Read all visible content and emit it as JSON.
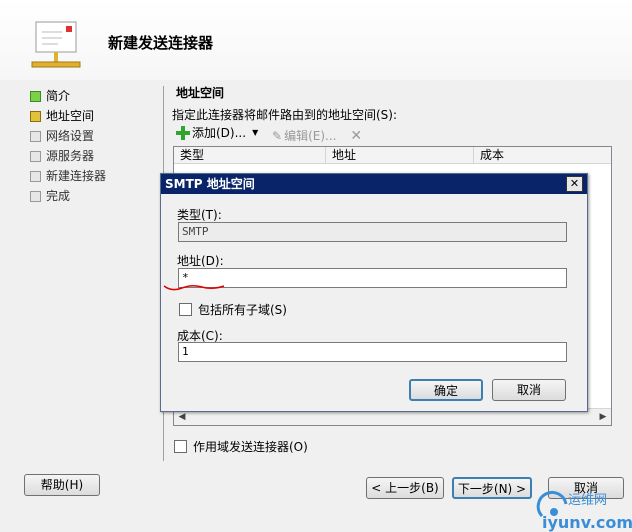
{
  "wizard": {
    "title": "新建发送连接器",
    "steps": [
      {
        "label": "简介",
        "state": "done"
      },
      {
        "label": "地址空间",
        "state": "current"
      },
      {
        "label": "网络设置",
        "state": "pending"
      },
      {
        "label": "源服务器",
        "state": "pending"
      },
      {
        "label": "新建连接器",
        "state": "pending"
      },
      {
        "label": "完成",
        "state": "pending"
      }
    ]
  },
  "main": {
    "section_title": "地址空间",
    "description": "指定此连接器将邮件路由到的地址空间(S):",
    "toolbar": {
      "add": "添加(D)...",
      "edit": "编辑(E)..."
    },
    "columns": [
      "类型",
      "地址",
      "成本"
    ],
    "scoped_checkbox": "作用域发送连接器(O)"
  },
  "buttons": {
    "help": "帮助(H)",
    "back": "< 上一步(B)",
    "next": "下一步(N) >",
    "cancel": "取消"
  },
  "dialog": {
    "title": "SMTP 地址空间",
    "close": "✕",
    "type_label": "类型(T):",
    "type_value": "SMTP",
    "address_label": "地址(D):",
    "address_value": "*",
    "subdomains_label": "包括所有子域(S)",
    "cost_label": "成本(C):",
    "cost_value": "1",
    "ok": "确定",
    "cancel": "取消"
  },
  "watermark": {
    "brand": "运维网",
    "site": "iyunv.com"
  },
  "colors": {
    "title_bar": "#0a246a",
    "step_done": "#7bd04a",
    "step_current": "#e2c23a",
    "annotation": "#e00000"
  }
}
